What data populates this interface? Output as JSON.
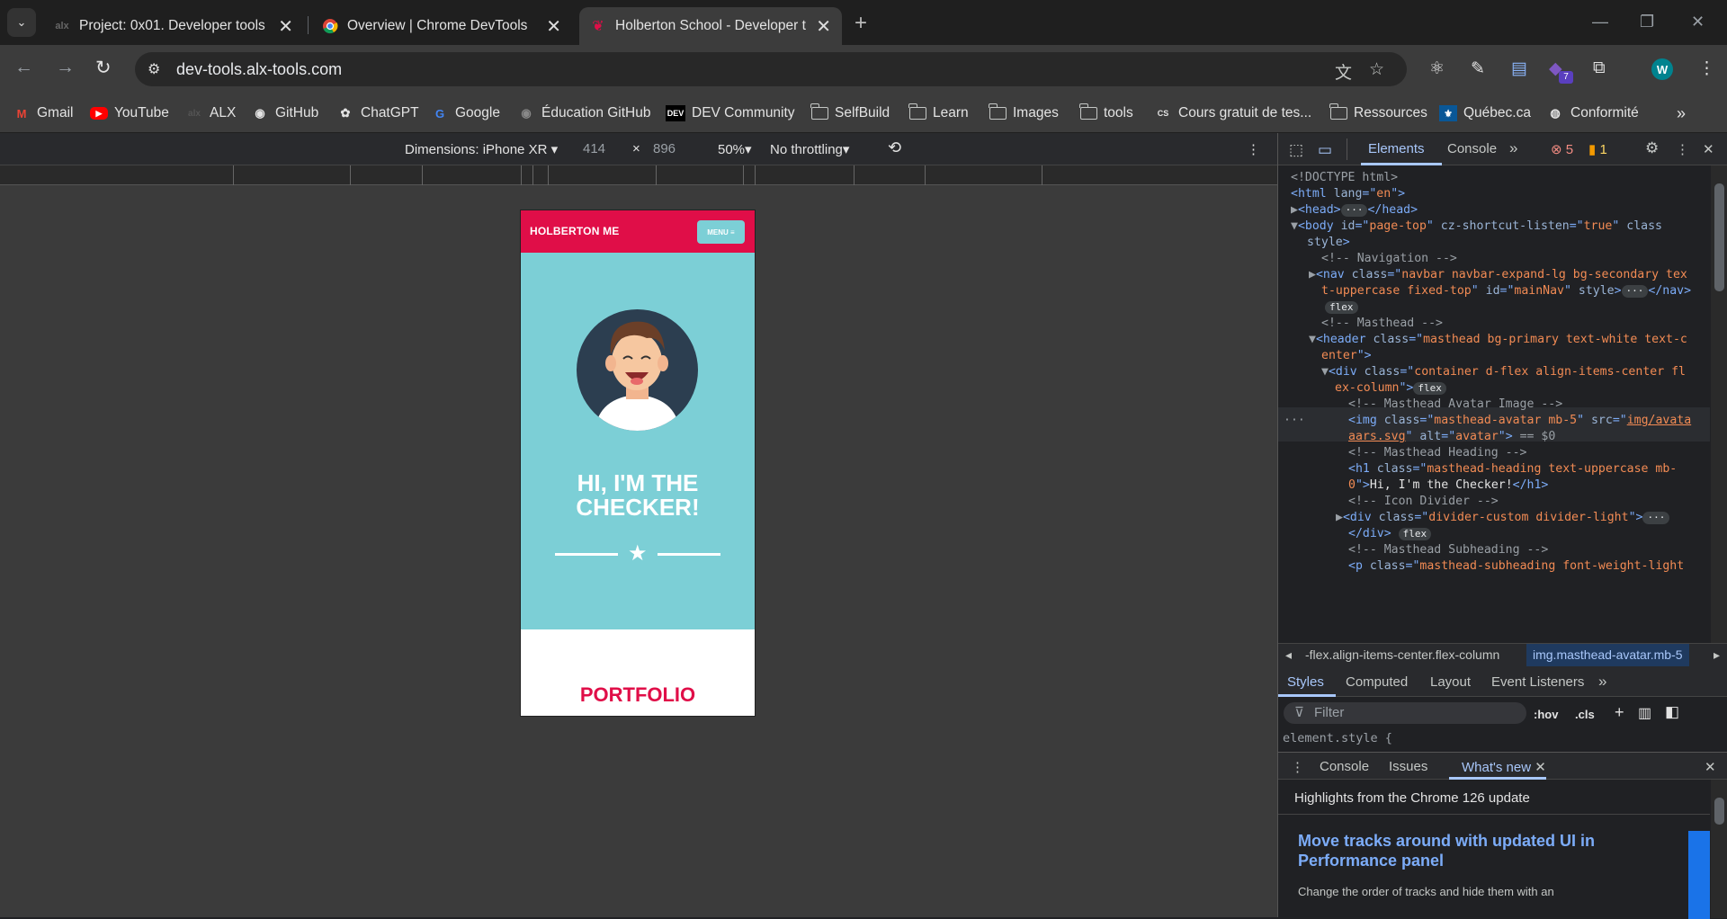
{
  "tabs": [
    {
      "title": "Project: 0x01. Developer tools |",
      "favicon": "alx-icon"
    },
    {
      "title": "Overview  |  Chrome DevTools",
      "favicon": "chrome-icon"
    },
    {
      "title": "Holberton School - Developer t",
      "favicon": "holberton-icon"
    }
  ],
  "url": "dev-tools.alx-tools.com",
  "extension_badge": "7",
  "profile_initial": "W",
  "bookmarks": [
    "Gmail",
    "YouTube",
    "ALX",
    "GitHub",
    "ChatGPT",
    "Google",
    "Éducation GitHub",
    "DEV Community",
    "SelfBuild",
    "Learn",
    "Images",
    "tools",
    "Cours gratuit de tes...",
    "Ressources",
    "Québec.ca",
    "Conformité"
  ],
  "device_toolbar": {
    "dimensions": "Dimensions: iPhone XR",
    "width": "414",
    "times": "×",
    "height": "896",
    "zoom": "50%",
    "throttling": "No throttling"
  },
  "page": {
    "brand": "HOLBERTON ME",
    "menu": "MENU ≡",
    "heading_line1": "HI, I'M THE",
    "heading_line2": "CHECKER!",
    "portfolio": "PORTFOLIO"
  },
  "devtools": {
    "tabs": [
      "Elements",
      "Console"
    ],
    "errors": "5",
    "warnings": "1",
    "breadcrumb_left": "-flex.align-items-center.flex-column",
    "breadcrumb_right": "img.masthead-avatar.mb-5",
    "style_tabs": [
      "Styles",
      "Computed",
      "Layout",
      "Event Listeners"
    ],
    "filter_placeholder": "Filter",
    "hov": ":hov",
    "cls": ".cls",
    "element_style": "element.style {",
    "drawer_tabs": [
      "Console",
      "Issues",
      "What's new"
    ],
    "highlights": "Highlights from the Chrome 126 update",
    "whatsnew_title": "Move tracks around with updated UI in Performance panel",
    "whatsnew_body": "Change the order of tracks and hide them with an"
  },
  "colors": {
    "accent": "#e00e48",
    "teal": "#7ccfd6",
    "devtools_blue": "#a8c7fa"
  }
}
